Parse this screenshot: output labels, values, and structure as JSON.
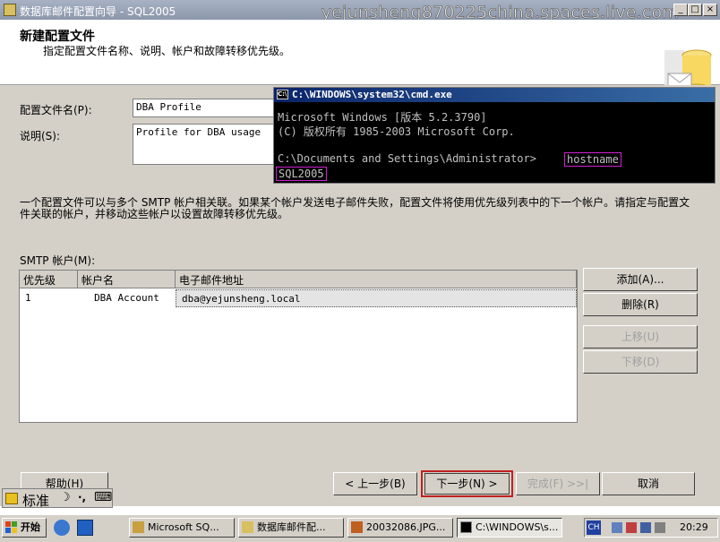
{
  "window": {
    "title": "数据库邮件配置向导 - SQL2005",
    "watermark": "yejunsheng870225china.spaces.live.com",
    "min_label": "_",
    "max_label": "□",
    "close_label": "×"
  },
  "header": {
    "title": "新建配置文件",
    "subtitle": "指定配置文件名称、说明、帐户和故障转移优先级。"
  },
  "form": {
    "profile_name_label": "配置文件名(P):",
    "profile_name_value": "DBA Profile",
    "description_label": "说明(S):",
    "description_value": "Profile for DBA usage",
    "info_text_line1": "一个配置文件可以与多个 SMTP 帐户相关联。如果某个帐户发送电子邮件失败，配置文件将使用优先级列表中的下一个帐户。请指定与配置文",
    "info_text_line2": "件关联的帐户，并移动这些帐户以设置故障转移优先级。",
    "smtp_label": "SMTP 帐户(M):"
  },
  "table": {
    "columns": [
      "优先级",
      "帐户名",
      "电子邮件地址"
    ],
    "rows": [
      {
        "priority": "1",
        "account": "DBA Account",
        "email": "dba@yejunsheng.local"
      }
    ]
  },
  "side_buttons": {
    "add": "添加(A)...",
    "remove": "删除(R)",
    "move_up": "上移(U)",
    "move_down": "下移(D)"
  },
  "footer_buttons": {
    "help": "帮助(H)",
    "back": "< 上一步(B)",
    "next": "下一步(N) >",
    "finish": "完成(F) >>|",
    "cancel": "取消"
  },
  "cmd": {
    "title": "C:\\WINDOWS\\system32\\cmd.exe",
    "icon_text": "C:\\",
    "line1": "Microsoft Windows [版本 5.2.3790]",
    "line2": "(C) 版权所有 1985-2003 Microsoft Corp.",
    "prompt": "C:\\Documents and Settings\\Administrator>",
    "command": "hostname",
    "output": "SQL2005"
  },
  "ime": {
    "label": "标准",
    "moon": "☽",
    "punct": "·,",
    "kbd": "⌨"
  },
  "taskbar": {
    "start": "开始",
    "items": [
      "Microsoft SQ...",
      "数据库邮件配...",
      "20032086.JPG...",
      "C:\\WINDOWS\\s..."
    ],
    "lang": "CH",
    "clock": "20:29"
  }
}
